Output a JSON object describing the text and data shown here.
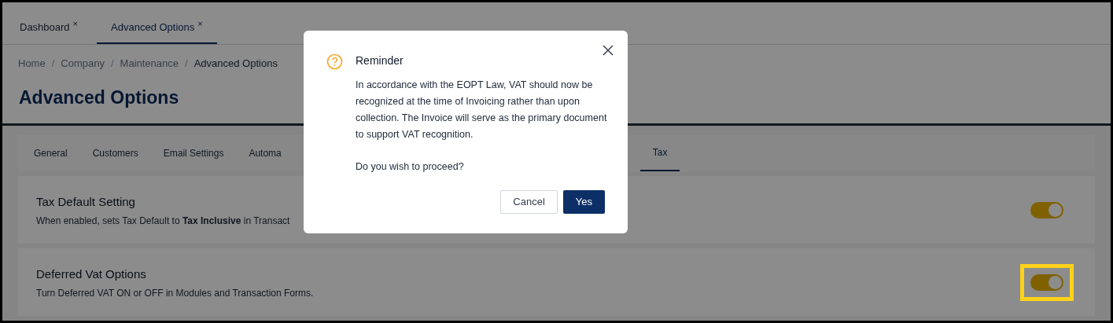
{
  "open_tabs": [
    {
      "label": "Dashboard",
      "close": "×",
      "selected": false
    },
    {
      "label": "Advanced Options",
      "close": "×",
      "selected": true
    }
  ],
  "breadcrumb": [
    "Home",
    "Company",
    "Maintenance",
    "Advanced Options"
  ],
  "breadcrumb_separator": "/",
  "page_title": "Advanced Options",
  "section_tabs": [
    {
      "label": "General",
      "selected": false
    },
    {
      "label": "Customers",
      "selected": false
    },
    {
      "label": "Email Settings",
      "selected": false
    },
    {
      "label": "Automa",
      "selected": false
    },
    {
      "label": "Tax",
      "selected": true
    }
  ],
  "settings": [
    {
      "title": "Tax Default Setting",
      "description": "When enabled, sets Tax Default to **Tax Inclusive** in Transact",
      "on": true,
      "highlighted": false
    },
    {
      "title": "Deferred Vat Options",
      "description": "Turn Deferred VAT ON or OFF in Modules and Transaction Forms.",
      "on": true,
      "highlighted": true
    }
  ],
  "dialog": {
    "title": "Reminder",
    "message": "In accordance with the EOPT Law, VAT should now be recognized at the time of Invoicing rather than upon collection. The Invoice will serve as the primary document to support VAT recognition.",
    "question": "Do you wish to proceed?",
    "buttons": [
      {
        "label": "Cancel",
        "kind": "secondary"
      },
      {
        "label": "Yes",
        "kind": "primary"
      }
    ]
  }
}
